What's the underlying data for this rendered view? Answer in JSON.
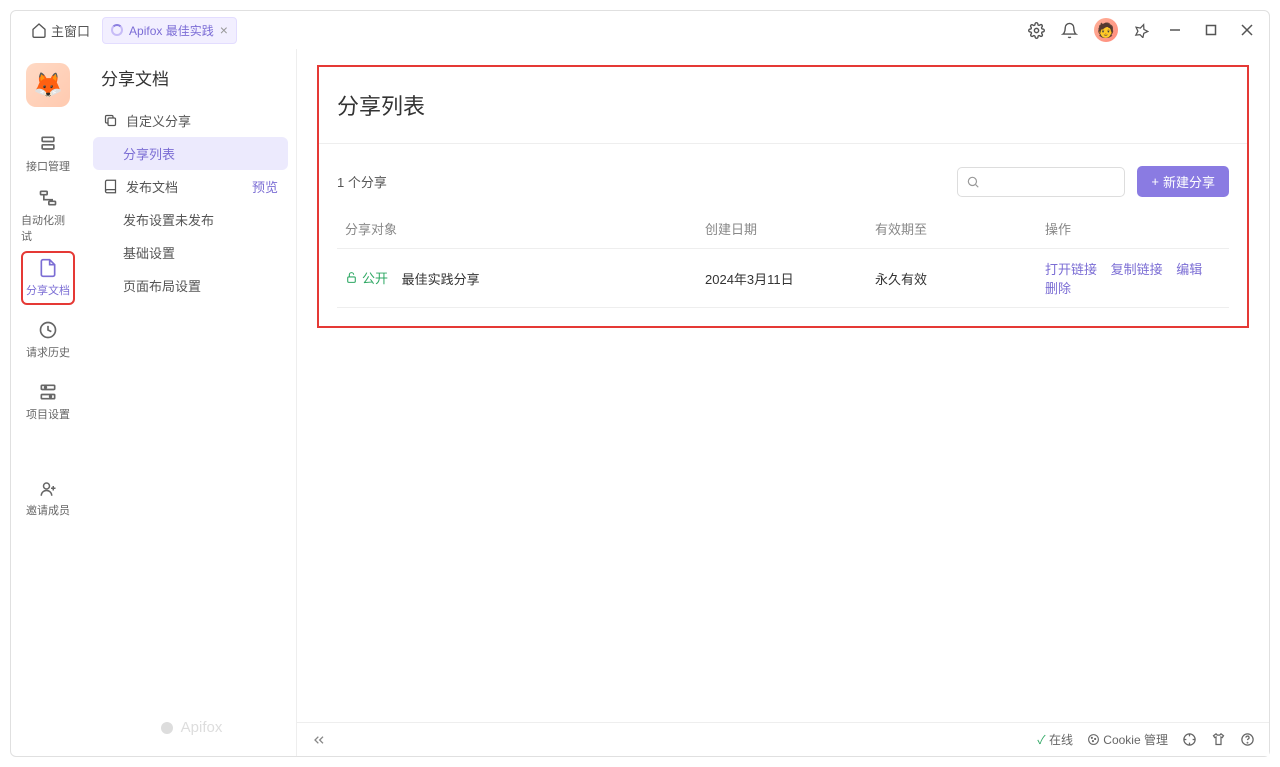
{
  "topbar": {
    "home_label": "主窗口",
    "tab_label": "Apifox 最佳实践"
  },
  "nav": {
    "items": [
      {
        "label": "接口管理"
      },
      {
        "label": "自动化测试"
      },
      {
        "label": "分享文档"
      },
      {
        "label": "请求历史"
      },
      {
        "label": "项目设置"
      }
    ],
    "invite_label": "邀请成员"
  },
  "sidebar": {
    "title": "分享文档",
    "custom_share": "自定义分享",
    "share_list": "分享列表",
    "publish_doc": "发布文档",
    "preview": "预览",
    "publish_settings": "发布设置",
    "unpublished": "未发布",
    "basic_settings": "基础设置",
    "layout_settings": "页面布局设置",
    "brand": "Apifox"
  },
  "content": {
    "title": "分享列表",
    "count_label": "1 个分享",
    "new_button": "新建分享",
    "columns": {
      "target": "分享对象",
      "created": "创建日期",
      "expire": "有效期至",
      "actions": "操作"
    },
    "rows": [
      {
        "visibility": "公开",
        "name": "最佳实践分享",
        "created": "2024年3月11日",
        "expire": "永久有效"
      }
    ],
    "actions": {
      "open": "打开链接",
      "copy": "复制链接",
      "edit": "编辑",
      "delete": "删除"
    }
  },
  "footer": {
    "online": "在线",
    "cookie": "Cookie 管理"
  }
}
